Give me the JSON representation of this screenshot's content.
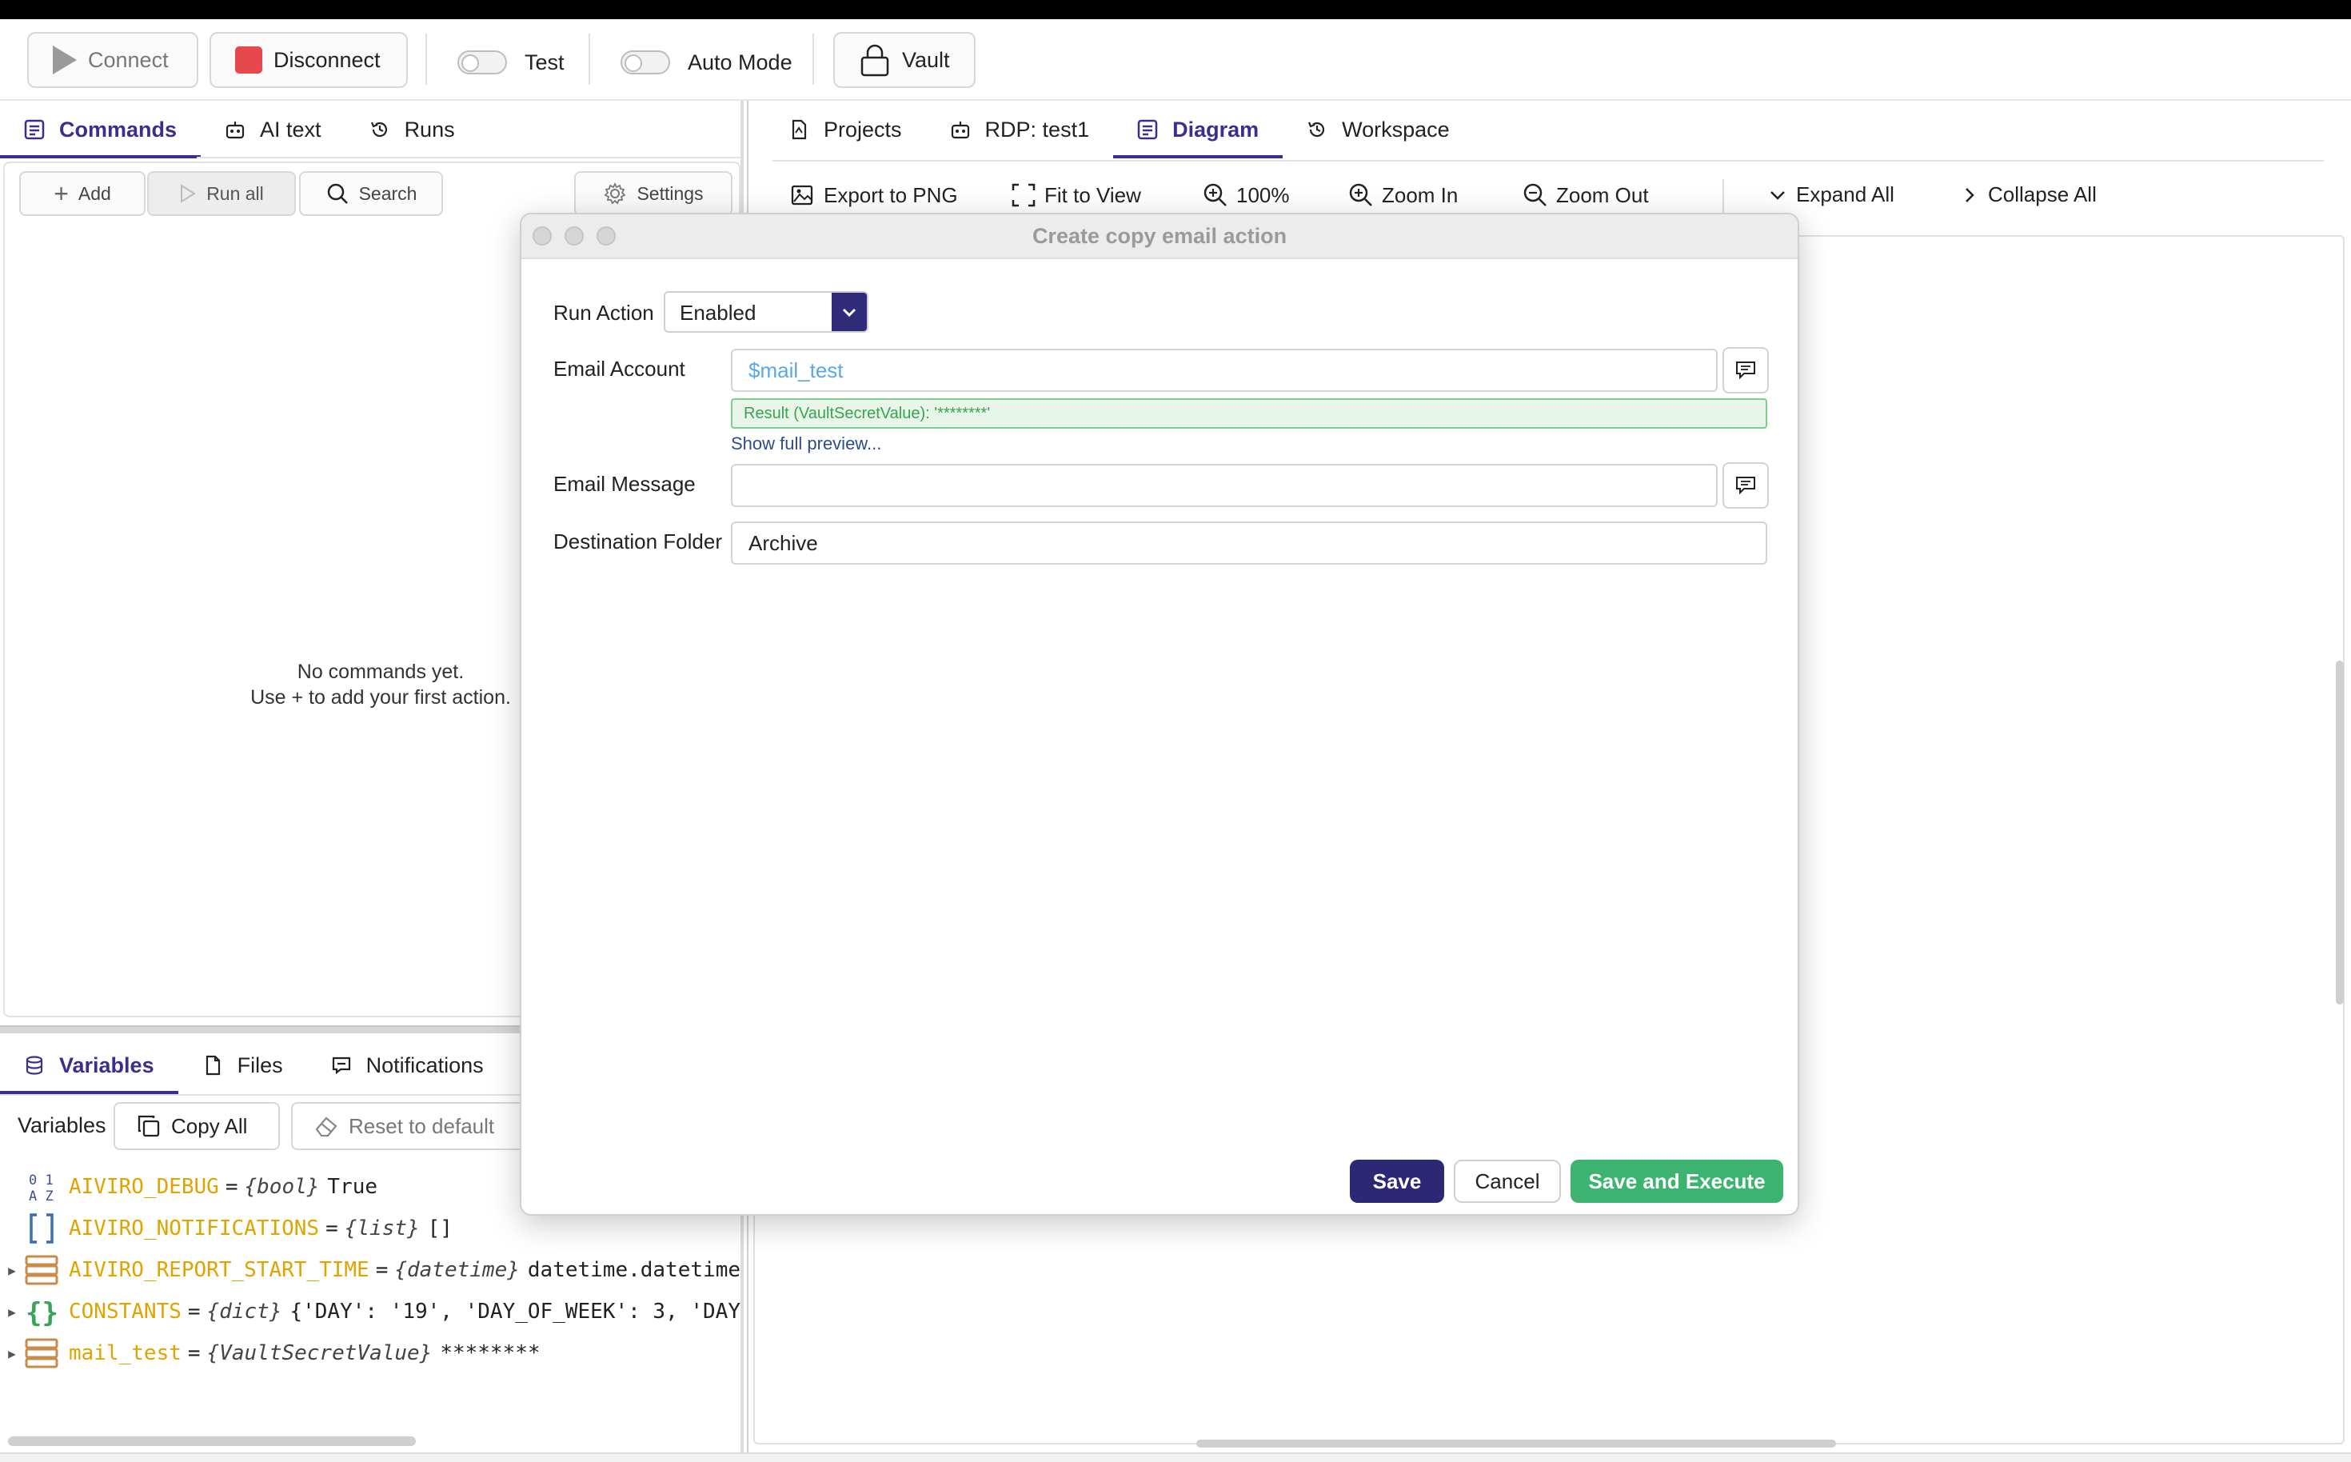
{
  "toolbar": {
    "connect_label": "Connect",
    "disconnect_label": "Disconnect",
    "test_label": "Test",
    "auto_mode_label": "Auto Mode",
    "vault_label": "Vault"
  },
  "left_tabs": [
    {
      "label": "Commands",
      "active": true
    },
    {
      "label": "AI text",
      "active": false
    },
    {
      "label": "Runs",
      "active": false
    }
  ],
  "commands": {
    "add_label": "Add",
    "run_all_label": "Run all",
    "search_label": "Search",
    "settings_label": "Settings",
    "empty_line1": "No commands yet.",
    "empty_line2": "Use + to add your first action."
  },
  "bottom_tabs": [
    {
      "label": "Variables",
      "active": true
    },
    {
      "label": "Files",
      "active": false
    },
    {
      "label": "Notifications",
      "active": false
    }
  ],
  "variables": {
    "label": "Variables",
    "copy_all_label": "Copy All",
    "reset_label": "Reset to default",
    "items": [
      {
        "name": "AIVIRO_DEBUG",
        "type": "{bool}",
        "value": "True",
        "icon": "bool-icon",
        "expandable": false
      },
      {
        "name": "AIVIRO_NOTIFICATIONS",
        "type": "{list}",
        "value": "[]",
        "icon": "list-icon",
        "expandable": false
      },
      {
        "name": "AIVIRO_REPORT_START_TIME",
        "type": "{datetime}",
        "value": "datetime.datetime",
        "icon": "object-icon",
        "expandable": true
      },
      {
        "name": "CONSTANTS",
        "type": "{dict}",
        "value": "{'DAY': '19', 'DAY_OF_WEEK': 3, 'DAY",
        "icon": "dict-icon",
        "expandable": true
      },
      {
        "name": "mail_test",
        "type": "{VaultSecretValue}",
        "value": "********",
        "icon": "object-icon",
        "expandable": true
      }
    ]
  },
  "right_tabs": [
    {
      "label": "Projects",
      "active": false
    },
    {
      "label": "RDP: test1",
      "active": false
    },
    {
      "label": "Diagram",
      "active": true
    },
    {
      "label": "Workspace",
      "active": false
    }
  ],
  "diagram_toolbar": {
    "export_label": "Export to PNG",
    "fit_label": "Fit to View",
    "zoom_level": "100%",
    "zoom_in_label": "Zoom In",
    "zoom_out_label": "Zoom Out",
    "expand_all_label": "Expand All",
    "collapse_all_label": "Collapse All"
  },
  "dialog": {
    "title": "Create copy email action",
    "run_action_label": "Run Action",
    "run_action_value": "Enabled",
    "email_account_label": "Email Account",
    "email_account_value": "$mail_test",
    "result_text": "Result (VaultSecretValue): '********'",
    "show_preview_label": "Show full preview...",
    "email_message_label": "Email Message",
    "email_message_value": "",
    "destination_folder_label": "Destination Folder",
    "destination_folder_value": "Archive",
    "save_label": "Save",
    "cancel_label": "Cancel",
    "save_execute_label": "Save and Execute"
  },
  "colors": {
    "accent": "#3a2f8f",
    "disconnect_red": "#e5484d",
    "execute_green": "#3cb371",
    "variable_name": "#e0a400",
    "result_green": "#3aa34e"
  }
}
